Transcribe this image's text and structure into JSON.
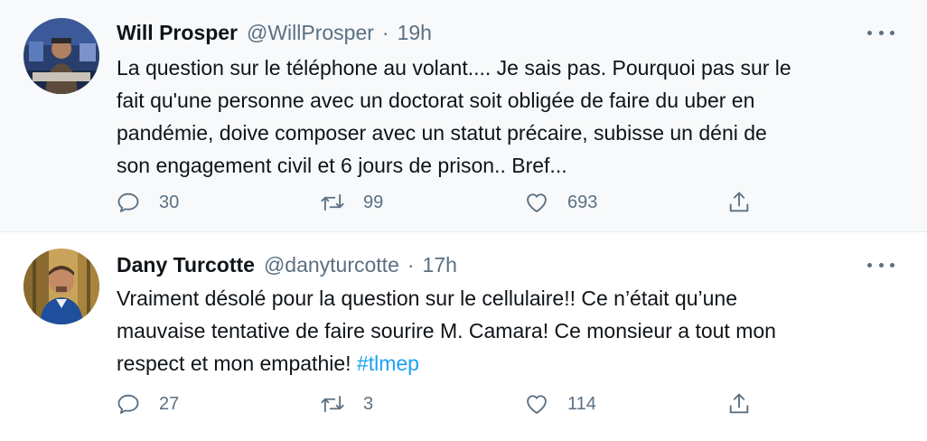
{
  "tweets": [
    {
      "name": "Will Prosper",
      "handle": "@WillProsper",
      "separator": "·",
      "time": "19h",
      "text_lines": [
        "La question sur le téléphone au volant.... Je sais pas. Pourquoi pas sur le",
        "fait qu'une personne avec un doctorat soit obligée de faire du uber en",
        "pandémie, doive composer avec un statut précaire, subisse un déni de",
        "son engagement civil et 6 jours de prison.. Bref..."
      ],
      "hashtag": "",
      "replies": "30",
      "retweets": "99",
      "likes": "693",
      "avatar_icon": "avatar-photo-icon"
    },
    {
      "name": "Dany Turcotte",
      "handle": "@danyturcotte",
      "separator": "·",
      "time": "17h",
      "text_lines": [
        "Vraiment désolé pour la question sur le cellulaire!! Ce n’était qu’une",
        "mauvaise tentative de faire sourire M. Camara! Ce monsieur a tout mon",
        "respect et mon empathie! "
      ],
      "hashtag": "#tlmep",
      "replies": "27",
      "retweets": "3",
      "likes": "114",
      "avatar_icon": "avatar-photo-icon"
    }
  ],
  "colors": {
    "text": "#0f1419",
    "secondary": "#5b7083",
    "link": "#1da1f2",
    "thread_bg": "#f7f9fa",
    "thread_line": "#c4cfd6"
  },
  "icons": {
    "reply": "reply-icon",
    "retweet": "retweet-icon",
    "like": "heart-icon",
    "share": "share-icon",
    "more": "more-icon"
  }
}
